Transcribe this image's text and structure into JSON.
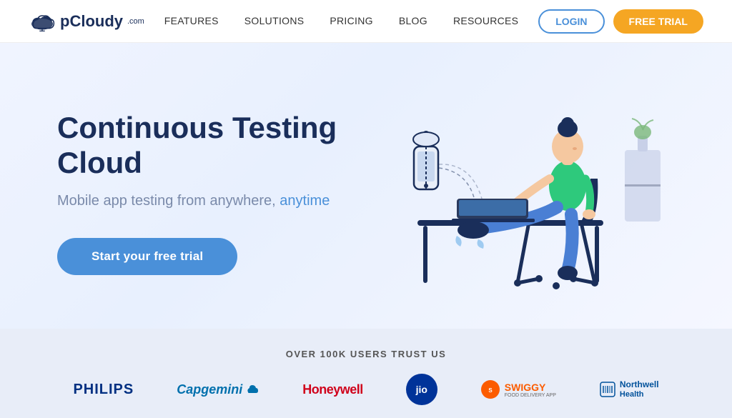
{
  "brand": {
    "name": "pCloudy",
    "suffix": ".com"
  },
  "navbar": {
    "links": [
      {
        "label": "FEATURES",
        "id": "features"
      },
      {
        "label": "SOLUTIONS",
        "id": "solutions"
      },
      {
        "label": "PRICING",
        "id": "pricing"
      },
      {
        "label": "BLOG",
        "id": "blog"
      },
      {
        "label": "RESOURCES",
        "id": "resources"
      }
    ],
    "login_label": "LOGIN",
    "trial_label": "FREE TRIAL"
  },
  "hero": {
    "title": "Continuous Testing Cloud",
    "subtitle_static": "Mobile app testing from anywhere, ",
    "subtitle_highlight": "anytime",
    "cta_label": "Start your free trial"
  },
  "trust": {
    "heading": "OVER 100K USERS TRUST US",
    "logos": [
      {
        "name": "PHILIPS",
        "style": "philips"
      },
      {
        "name": "Capgemini",
        "style": "capgemini"
      },
      {
        "name": "Honeywell",
        "style": "honeywell"
      },
      {
        "name": "jio",
        "style": "jio"
      },
      {
        "name": "SWIGGY",
        "style": "swiggy"
      },
      {
        "name": "Northwell\nHealth",
        "style": "northwell"
      }
    ]
  },
  "colors": {
    "accent_blue": "#4a90d9",
    "accent_orange": "#f5a623",
    "navy": "#1a2e5a",
    "light_bg": "#e8edf8"
  }
}
